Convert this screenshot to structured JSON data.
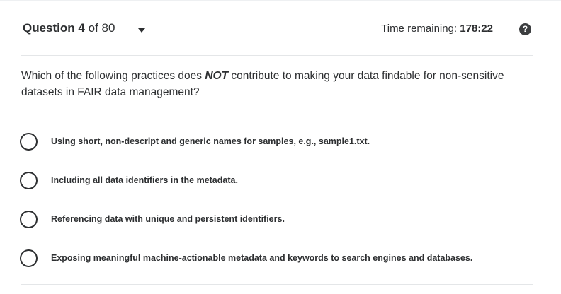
{
  "header": {
    "question_word": "Question",
    "question_number": "4",
    "question_of": "of 80",
    "timer_label": "Time remaining:",
    "timer_value": "178:22",
    "help_glyph": "?"
  },
  "question": {
    "text_before": "Which of the following practices does ",
    "emphasis": "NOT",
    "text_after": " contribute to making your data findable for non-sensitive datasets in FAIR data management?"
  },
  "options": [
    {
      "label": "Using short, non-descript and generic names for samples, e.g., sample1.txt."
    },
    {
      "label": "Including all data identifiers in the metadata."
    },
    {
      "label": "Referencing data with unique and persistent identifiers."
    },
    {
      "label": "Exposing meaningful machine-actionable metadata and keywords to search engines and databases."
    }
  ],
  "icons": {
    "dropdown": "chevron-down-icon",
    "help": "help-icon",
    "radio": "radio-unchecked-icon"
  },
  "colors": {
    "text": "#2d2f31",
    "divider": "#e4e6e8",
    "help_bg": "#3c3e40"
  }
}
